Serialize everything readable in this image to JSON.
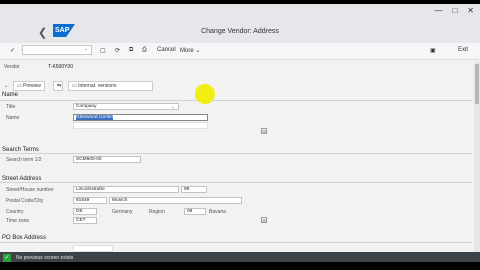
{
  "window": {
    "title": "Change Vendor: Address",
    "controls": [
      "—",
      "□",
      "✕"
    ]
  },
  "toolbar": {
    "cancel": "Cancel",
    "more": "More",
    "exit": "Exit"
  },
  "header": {
    "vendor_label": "Vendor",
    "vendor_value": "T-K500Y00",
    "preview": "Preview",
    "internat": "Internat. versions"
  },
  "name_section": {
    "title": "Name",
    "title_label": "Title",
    "title_value": "Company",
    "name_label": "Name",
    "name_value": "Glenwood Center"
  },
  "search_terms": {
    "title": "Search Terms",
    "label": "Search term 1/2",
    "value": "SCM500-00"
  },
  "street": {
    "title": "Street Address",
    "street_label": "Street/House number",
    "street_value": "Lincolnstraße",
    "house_value": "99",
    "city_label": "Postal Code/City",
    "postal_value": "81549",
    "city_value": "Munich",
    "country_label": "Country",
    "country_value": "DE",
    "country_name": "Germany",
    "region_label": "Region",
    "region_value": "09",
    "region_name": "Bavaria",
    "tz_label": "Time zone",
    "tz_value": "CET"
  },
  "pobox": {
    "title": "PO Box Address"
  },
  "status": {
    "text": "No previous screen exists"
  }
}
